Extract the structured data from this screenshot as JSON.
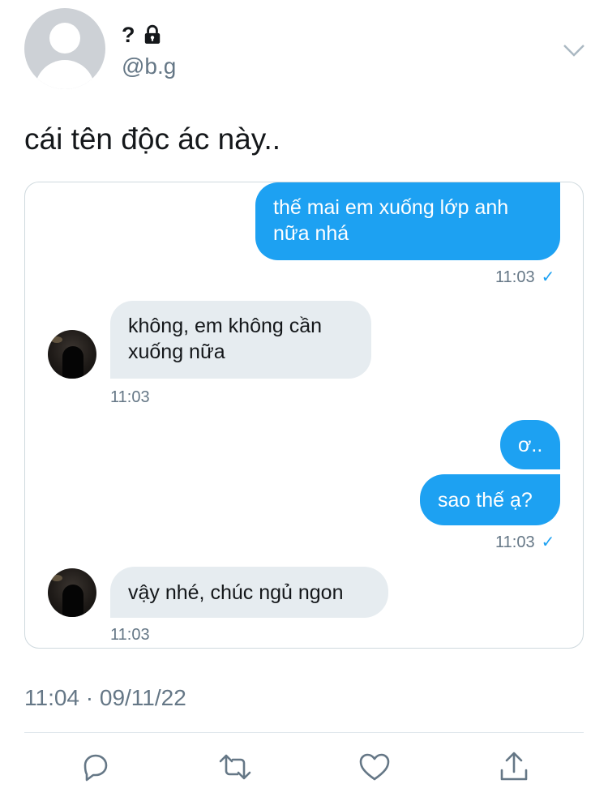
{
  "header": {
    "name": "?",
    "handle": "@b.g"
  },
  "tweet": {
    "text": "cái tên độc ác này..",
    "timestamp": "11:04 · 09/11/22"
  },
  "conversation": {
    "messages": [
      {
        "side": "sent",
        "lines": [
          "thế mai em xuống lớp anh",
          "nữa nhá"
        ]
      },
      {
        "side": "recv",
        "lines": [
          "không, em không cần",
          "xuống nữa"
        ]
      },
      {
        "side": "sent",
        "lines": [
          "ơ.."
        ]
      },
      {
        "side": "sent",
        "lines": [
          "sao thế ạ?"
        ]
      },
      {
        "side": "recv",
        "lines": [
          "vậy nhé, chúc ngủ ngon"
        ]
      }
    ],
    "times": [
      "11:03",
      "11:03",
      "11:03",
      "11:03"
    ],
    "read_mark": "✓"
  },
  "colors": {
    "accent": "#1da1f2",
    "bubble_received": "#e6ecf0",
    "secondary_text": "#657786"
  },
  "actions": [
    "reply-icon",
    "retweet-icon",
    "like-icon",
    "share-icon"
  ]
}
